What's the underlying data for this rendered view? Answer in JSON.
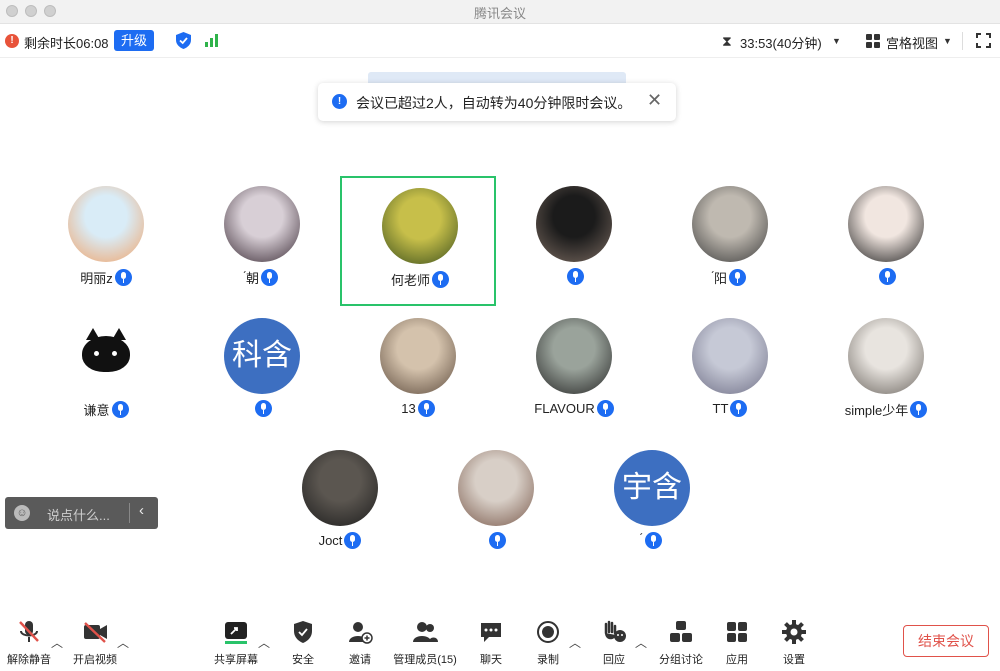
{
  "window": {
    "title": "腾讯会议"
  },
  "infobar": {
    "remaining_label": "剩余时长06:08",
    "upgrade_label": "升级",
    "timer": "33:53(40分钟)",
    "view_label": "宫格视图"
  },
  "toast": {
    "message": "会议已超过2人，自动转为40分钟限时会议。"
  },
  "participants": [
    {
      "name": "明丽z",
      "avatar": "cartoon-rabbit-avatar",
      "colors": [
        "#d9ecf7",
        "#f0a36a"
      ]
    },
    {
      "name": "́朝",
      "avatar": "dark-portrait-avatar",
      "colors": [
        "#d8cfd6",
        "#3a2b35"
      ]
    },
    {
      "name": "何老师",
      "avatar": "forest-deer-avatar",
      "active": true,
      "colors": [
        "#c7bf4a",
        "#3b4f1c"
      ]
    },
    {
      "name": "",
      "avatar": "selfie-avatar",
      "colors": [
        "#1b1b1b",
        "#7a6a60"
      ]
    },
    {
      "name": "́阳",
      "avatar": "street-photo-avatar",
      "colors": [
        "#bfb9b0",
        "#3b3b3b"
      ]
    },
    {
      "name": "",
      "avatar": "smiling-girl-avatar",
      "colors": [
        "#f1e6e0",
        "#1e1e1e"
      ]
    },
    {
      "name": "谦意",
      "avatar": "black-cat-avatar",
      "colors": [
        "#ffffff",
        "#111111"
      ]
    },
    {
      "name": "",
      "avatar_text": "科含",
      "colors": [
        "#3d6fc1",
        "#3d6fc1"
      ]
    },
    {
      "name": "13",
      "avatar": "child-photo-avatar",
      "colors": [
        "#d4c2ac",
        "#5d4b3d"
      ]
    },
    {
      "name": "FLAVOUR",
      "avatar": "dark-figure-avatar",
      "colors": [
        "#9aa39b",
        "#242424"
      ]
    },
    {
      "name": "TT",
      "avatar": "blurry-figure-avatar",
      "colors": [
        "#c6c9d6",
        "#6f6f86"
      ]
    },
    {
      "name": "simple少年",
      "avatar": "husky-dog-avatar",
      "colors": [
        "#e8e4df",
        "#6c6660"
      ]
    },
    {
      "name": "Joct",
      "avatar": "man-with-cat-avatar",
      "colors": [
        "#5b5650",
        "#1c1c1c"
      ]
    },
    {
      "name": "",
      "avatar": "little-girl-avatar",
      "colors": [
        "#d8cfc7",
        "#7a5a4c"
      ]
    },
    {
      "name": "́",
      "avatar_text": "宇含",
      "colors": [
        "#3d6fc1",
        "#3d6fc1"
      ]
    }
  ],
  "chat": {
    "placeholder": "说点什么..."
  },
  "toolbar": {
    "unmute": "解除静音",
    "start_video": "开启视频",
    "share_screen": "共享屏幕",
    "security": "安全",
    "invite": "邀请",
    "manage_members": "管理成员(15)",
    "chat": "聊天",
    "record": "录制",
    "react": "回应",
    "breakout": "分组讨论",
    "apps": "应用",
    "settings": "设置",
    "end_meeting": "结束会议"
  },
  "colors": {
    "accent": "#1d6cf2",
    "active_border": "#29c36a",
    "danger": "#e0524a",
    "text_avatar_bg": "#3d6fc1"
  }
}
